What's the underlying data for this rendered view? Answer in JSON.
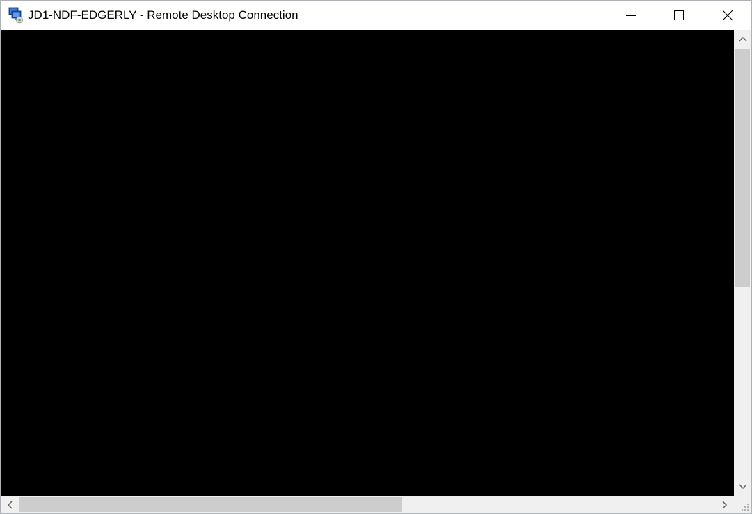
{
  "window": {
    "title": "JD1-NDF-EDGERLY - Remote Desktop Connection",
    "app_icon": "remote-desktop-icon"
  },
  "caption_buttons": {
    "minimize_icon": "minimize-icon",
    "maximize_icon": "maximize-icon",
    "close_icon": "close-icon"
  },
  "remote_display": {
    "background_color": "#000000"
  },
  "scrollbars": {
    "vertical": {
      "up_icon": "chevron-up-icon",
      "down_icon": "chevron-down-icon"
    },
    "horizontal": {
      "left_icon": "chevron-left-icon",
      "right_icon": "chevron-right-icon"
    }
  },
  "colors": {
    "titlebar_bg": "#ffffff",
    "scrollbar_track": "#f0f0f0",
    "scrollbar_thumb": "#cdcdcd"
  }
}
